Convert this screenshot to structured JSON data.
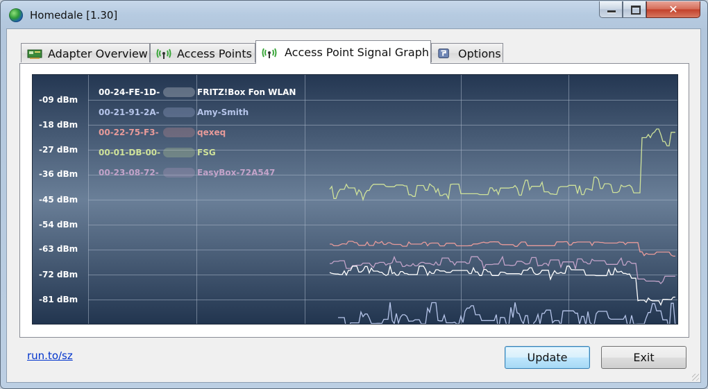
{
  "window": {
    "title": "Homedale [1.30]",
    "close_symbol": "✕"
  },
  "tabs": [
    {
      "label": "Adapter Overview",
      "icon": "network-card-icon",
      "active": false
    },
    {
      "label": "Access Points",
      "icon": "antenna-icon",
      "active": false
    },
    {
      "label": "Access Point Signal Graph",
      "icon": "antenna-icon",
      "active": true
    },
    {
      "label": "Options",
      "icon": "options-icon",
      "active": false
    }
  ],
  "graph": {
    "y_tick_labels": [
      "-09 dBm",
      "-18 dBm",
      "-27 dBm",
      "-36 dBm",
      "-45 dBm",
      "-54 dBm",
      "-63 dBm",
      "-72 dBm",
      "-81 dBm"
    ],
    "colors": {
      "background_top": "#243752",
      "background_mid": "#6a7f98",
      "background_bottom": "#22354f",
      "grid": "#a9b7c8"
    },
    "legend": [
      {
        "mac_prefix": "00-24-FE-1D-",
        "name": "FRITZ!Box Fon WLAN",
        "color": "#ffffff"
      },
      {
        "mac_prefix": "00-21-91-2A-",
        "name": "Amy-Smith",
        "color": "#b6c5ea"
      },
      {
        "mac_prefix": "00-22-75-F3-",
        "name": "qexeq",
        "color": "#e89b9a"
      },
      {
        "mac_prefix": "00-01-DB-00-",
        "name": "FSG",
        "color": "#cfe29a"
      },
      {
        "mac_prefix": "00-23-08-72-",
        "name": "EasyBox-72A547",
        "color": "#c2a3c9"
      }
    ]
  },
  "footer": {
    "link_text": "run.to/sz",
    "update_label": "Update",
    "exit_label": "Exit"
  }
}
